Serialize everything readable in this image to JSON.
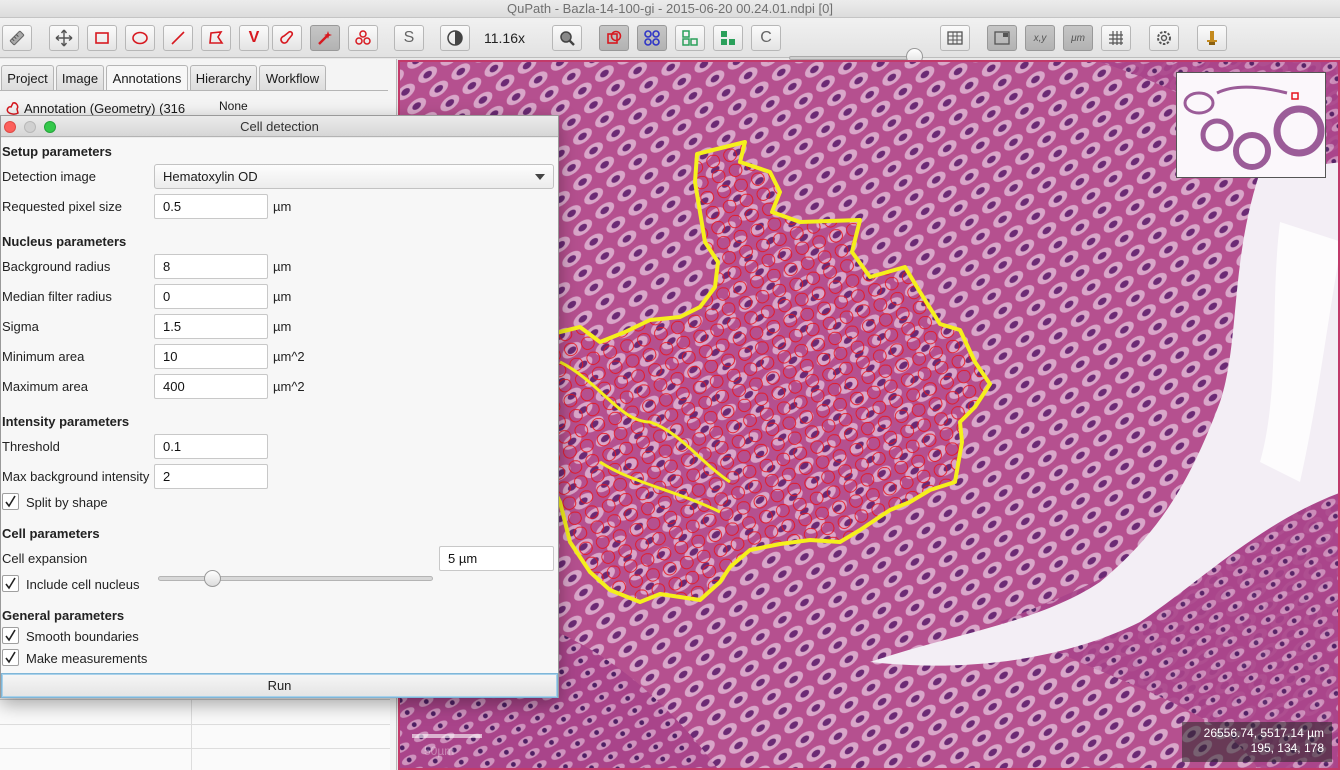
{
  "window": {
    "title": "QuPath - Bazla-14-100-gi - 2015-06-20 00.24.01.ndpi [0]"
  },
  "toolbar": {
    "zoom": "11.16x",
    "items": [
      {
        "name": "brush-tool-icon",
        "on": false
      },
      {
        "name": "move-tool-icon",
        "on": false
      },
      {
        "name": "rectangle-tool-icon",
        "on": false
      },
      {
        "name": "ellipse-tool-icon",
        "on": false
      },
      {
        "name": "line-tool-icon",
        "on": false
      },
      {
        "name": "polygon-tool-icon",
        "on": false
      },
      {
        "name": "polyline-tool-icon",
        "on": false
      },
      {
        "name": "brush-icon",
        "on": false
      },
      {
        "name": "wand-tool-icon",
        "on": true
      },
      {
        "name": "points-tool-icon",
        "on": false
      },
      {
        "name": "selection-mode-icon",
        "on": false
      },
      {
        "name": "brightness-contrast-icon",
        "on": false
      },
      {
        "name": "zoom-to-fit-icon",
        "on": false
      },
      {
        "name": "show-annotations-icon",
        "on": true
      },
      {
        "name": "show-tma-grid-icon",
        "on": true
      },
      {
        "name": "show-detections-icon",
        "on": false
      },
      {
        "name": "fill-detections-icon",
        "on": false
      },
      {
        "name": "show-connections-icon",
        "on": false
      },
      {
        "name": "measurement-table-icon",
        "on": false
      },
      {
        "name": "show-overview-icon",
        "on": true
      },
      {
        "name": "show-cursor-location-icon",
        "on": true
      },
      {
        "name": "show-scalebar-icon",
        "on": true
      },
      {
        "name": "show-grid-icon",
        "on": false
      },
      {
        "name": "preferences-icon",
        "on": false
      },
      {
        "name": "log-icon",
        "on": false
      }
    ],
    "labels": {
      "selection_mode": "S",
      "polyline": "V",
      "connections": "C",
      "coords": "x,y",
      "scalebar": "μm"
    }
  },
  "leftpanel": {
    "tabs": [
      "Project",
      "Image",
      "Annotations",
      "Hierarchy",
      "Workflow"
    ],
    "active_tab": "Annotations",
    "annotation_row": {
      "label": "Annotation (Geometry) (316",
      "class": "None"
    }
  },
  "dialog": {
    "title": "Cell detection",
    "sections": {
      "setup": "Setup parameters",
      "nucleus": "Nucleus parameters",
      "intensity": "Intensity parameters",
      "cell": "Cell parameters",
      "general": "General parameters"
    },
    "detection_image": {
      "label": "Detection image",
      "value": "Hematoxylin OD"
    },
    "pixel_size": {
      "label": "Requested pixel size",
      "value": "0.5",
      "unit": "µm"
    },
    "background_radius": {
      "label": "Background radius",
      "value": "8",
      "unit": "µm"
    },
    "median_radius": {
      "label": "Median filter radius",
      "value": "0",
      "unit": "µm"
    },
    "sigma": {
      "label": "Sigma",
      "value": "1.5",
      "unit": "µm"
    },
    "min_area": {
      "label": "Minimum area",
      "value": "10",
      "unit": "µm^2"
    },
    "max_area": {
      "label": "Maximum area",
      "value": "400",
      "unit": "µm^2"
    },
    "threshold": {
      "label": "Threshold",
      "value": "0.1"
    },
    "max_bg_intensity": {
      "label": "Max background intensity",
      "value": "2"
    },
    "split_by_shape": {
      "label": "Split by shape",
      "checked": true
    },
    "cell_expansion": {
      "label": "Cell expansion",
      "value": "5 µm",
      "slider_fraction": 0.18
    },
    "include_nucleus": {
      "label": "Include cell nucleus",
      "checked": true
    },
    "smooth_boundaries": {
      "label": "Smooth boundaries",
      "checked": true
    },
    "make_measurements": {
      "label": "Make measurements",
      "checked": true
    },
    "run_label": "Run"
  },
  "viewer": {
    "coords_line1": "26556.74, 5517.14 µm",
    "coords_line2": "195, 134, 178",
    "scalebar_label": "50µm",
    "colors": {
      "annotation": "#f5f01c",
      "detections": "#e8141e",
      "tissue": "#b2498e"
    }
  }
}
